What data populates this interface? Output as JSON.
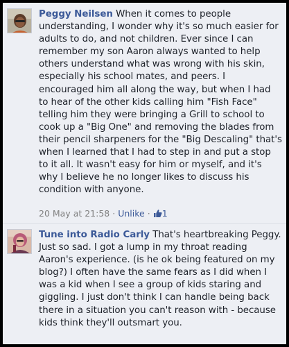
{
  "comments": [
    {
      "author": "Peggy Neilsen",
      "text": "When it comes to people understanding, I wonder why it's so much easier for adults to do, and not children. Ever since I can remember my son Aaron always wanted to help others understand what was wrong with his skin, especially his school mates, and peers. I encouraged him all along the way, but when I had to hear of the other kids calling him \"Fish Face\" telling him they were bringing a Grill to school to cook up a \"Big One\" and removing the blades from their pencil sharpeners for the \"Big Descaling\" that's when I learned that I had to step in and put a stop to it all. It wasn't easy for him or myself, and it's why I believe he no longer likes to discuss his condition with anyone.",
      "timestamp": "20 May at 21:58",
      "separator": "·",
      "unlike_label": "Unlike",
      "like_count": "1",
      "avatar_icon": "user-avatar-photo"
    },
    {
      "author": "Tune into Radio Carly",
      "text": "That's heartbreaking Peggy. Just so sad. I got a lump in my throat reading Aaron's experience. (is he ok being featured on my blog?) I often have the same fears as I did when I was a kid when I see a group of kids staring and giggling. I just don't think I can handle being back there in a situation you can't reason with - because kids think they'll outsmart you.",
      "avatar_icon": "user-avatar-photo"
    }
  ],
  "colors": {
    "link": "#3b5998",
    "background": "#edeff4",
    "text": "#1d2129",
    "meta": "#7f7f7f"
  }
}
